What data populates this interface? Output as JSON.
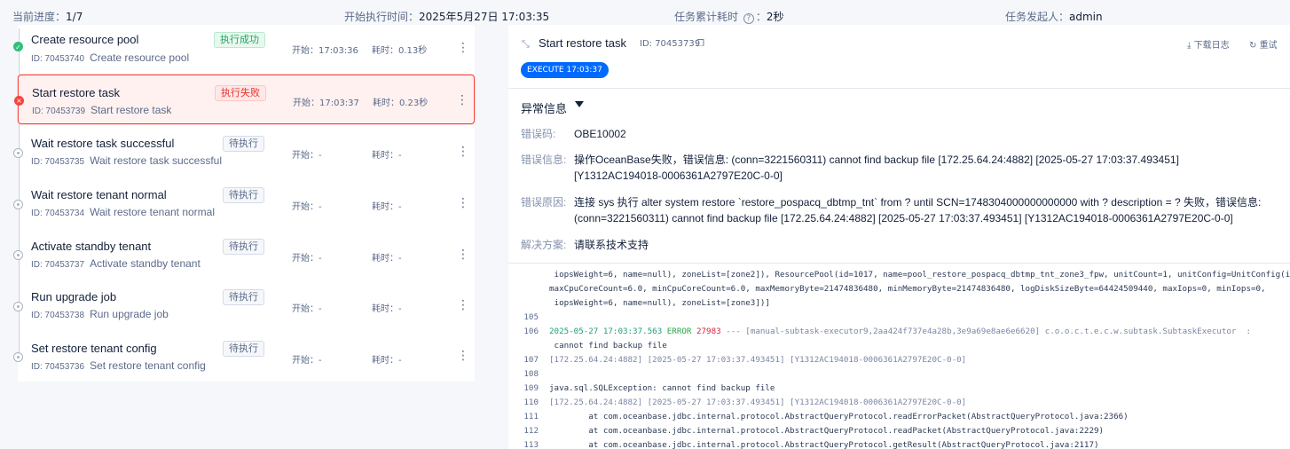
{
  "summary": {
    "progress_label": "当前进度：",
    "progress_value": "1/7",
    "start_label": "开始执行时间：",
    "start_value": "2025年5月27日 17:03:35",
    "elapsed_label": "任务累计耗时",
    "elapsed_value": "2秒",
    "initiator_label": "任务发起人：",
    "initiator_value": "admin"
  },
  "tasks": [
    {
      "name": "Create resource pool",
      "id": "ID: 70453740",
      "subname": "Create resource pool",
      "status": "执行成功",
      "start": "开始：17:03:36",
      "duration": "耗时：0.13秒"
    },
    {
      "name": "Start restore task",
      "id": "ID: 70453739",
      "subname": "Start restore task",
      "status": "执行失败",
      "start": "开始：17:03:37",
      "duration": "耗时：0.23秒"
    },
    {
      "name": "Wait restore task successful",
      "id": "ID: 70453735",
      "subname": "Wait restore task successful",
      "status": "待执行",
      "start": "开始：-",
      "duration": "耗时：-"
    },
    {
      "name": "Wait restore tenant normal",
      "id": "ID: 70453734",
      "subname": "Wait restore tenant normal",
      "status": "待执行",
      "start": "开始：-",
      "duration": "耗时：-"
    },
    {
      "name": "Activate standby tenant",
      "id": "ID: 70453737",
      "subname": "Activate standby tenant",
      "status": "待执行",
      "start": "开始：-",
      "duration": "耗时：-"
    },
    {
      "name": "Run upgrade job",
      "id": "ID: 70453738",
      "subname": "Run upgrade job",
      "status": "待执行",
      "start": "开始：-",
      "duration": "耗时：-"
    },
    {
      "name": "Set restore tenant config",
      "id": "ID: 70453736",
      "subname": "Set restore tenant config",
      "status": "待执行",
      "start": "开始：-",
      "duration": "耗时：-"
    }
  ],
  "detail": {
    "title": "Start restore task",
    "id": "ID: 70453739",
    "download_label": "下载日志",
    "retry_label": "重试",
    "exec_tag": "EXECUTE 17:03:37",
    "error_heading": "异常信息",
    "error_code_label": "错误码:",
    "error_code": "OBE10002",
    "error_info_label": "错误信息:",
    "error_info_line1": "操作OceanBase失败，错误信息: (conn=3221560311) cannot find backup file [172.25.64.24:4882] [2025-05-27 17:03:37.493451]",
    "error_info_line2": "[Y1312AC194018-0006361A2797E20C-0-0]",
    "error_reason_label": "错误原因:",
    "error_reason_line1": "连接 sys 执行 alter system restore `restore_pospacq_dbtmp_tnt` from ? until SCN=1748304000000000000 with ? description = ? 失败，错误信息:",
    "error_reason_line2": "(conn=3221560311) cannot find backup file [172.25.64.24:4882] [2025-05-27 17:03:37.493451] [Y1312AC194018-0006361A2797E20C-0-0]",
    "solution_label": "解决方案:",
    "solution": "请联系技术支持"
  },
  "log": {
    "l1": " iopsWeight=6, name=null), zoneList=[zone2]), ResourcePool(id=1017, name=pool_restore_pospacq_dbtmp_tnt_zone3_fpw, unitCount=1, unitConfig=UnitConfig(id=",
    "l2": "maxCpuCoreCount=6.0, minCpuCoreCount=6.0, maxMemoryByte=21474836480, minMemoryByte=21474836480, logDiskSizeByte=64424509440, maxIops=0, minIops=0,",
    "l3": " iopsWeight=6, name=null), zoneList=[zone3])]",
    "n105": "105",
    "n106": "106",
    "l106_ts": "2025-05-27 17:03:37.563 ",
    "l106_lvl": "ERROR",
    "l106_pid": " 27983",
    "l106_rest": " --- [manual-subtask-executor9,2aa424f737e4a28b,3e9a69e8ae6e6620] c.o.o.c.t.e.c.w.subtask.SubtaskExecutor  :",
    "l106b": " cannot find backup file",
    "n107": "107",
    "l107": "[172.25.64.24:4882] [2025-05-27 17:03:37.493451] [Y1312AC194018-0006361A2797E20C-0-0]",
    "n108": "108",
    "n109": "109",
    "l109": "java.sql.SQLException: cannot find backup file",
    "n110": "110",
    "l110": "[172.25.64.24:4882] [2025-05-27 17:03:37.493451] [Y1312AC194018-0006361A2797E20C-0-0]",
    "n111": "111",
    "l111": "        at com.oceanbase.jdbc.internal.protocol.AbstractQueryProtocol.readErrorPacket(AbstractQueryProtocol.java:2366)",
    "n112": "112",
    "l112": "        at com.oceanbase.jdbc.internal.protocol.AbstractQueryProtocol.readPacket(AbstractQueryProtocol.java:2229)",
    "n113": "113",
    "l113": "        at com.oceanbase.jdbc.internal.protocol.AbstractQueryProtocol.getResult(AbstractQueryProtocol.java:2117)"
  }
}
